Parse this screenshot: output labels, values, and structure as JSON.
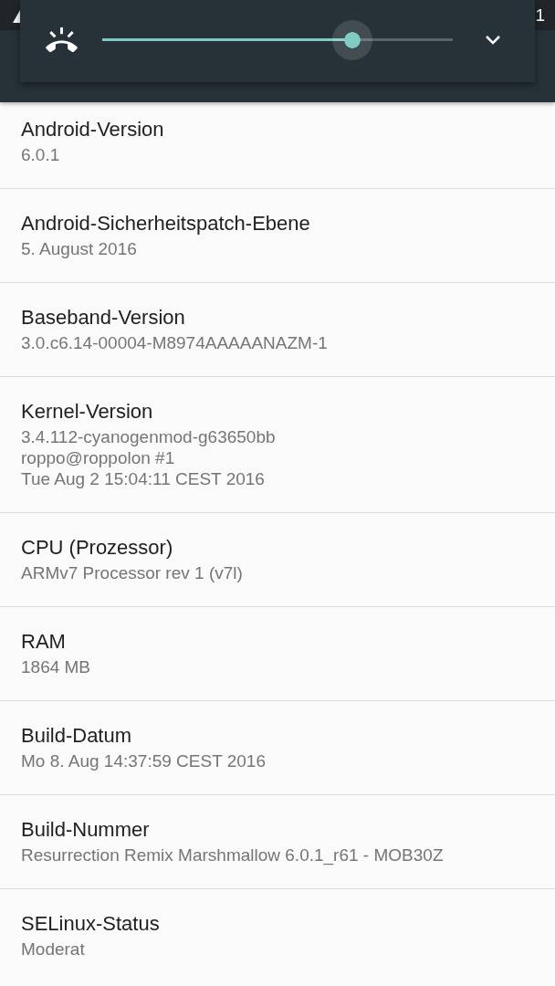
{
  "status_bar": {
    "clock": "1"
  },
  "volume_dialog": {
    "level": 0.713,
    "expanded": false
  },
  "items": [
    {
      "title": "Android-Version",
      "summary": "6.0.1"
    },
    {
      "title": "Android-Sicherheitspatch-Ebene",
      "summary": "5. August 2016"
    },
    {
      "title": "Baseband-Version",
      "summary": "3.0.c6.14-00004-M8974AAAAANAZM-1"
    },
    {
      "title": "Kernel-Version",
      "summary": "3.4.112-cyanogenmod-g63650bb\nroppo@roppolon #1\nTue Aug 2 15:04:11 CEST 2016"
    },
    {
      "title": "CPU (Prozessor)",
      "summary": "ARMv7 Processor rev 1 (v7l)"
    },
    {
      "title": "RAM",
      "summary": "1864 MB"
    },
    {
      "title": "Build-Datum",
      "summary": "Mo 8. Aug 14:37:59 CEST 2016"
    },
    {
      "title": "Build-Nummer",
      "summary": "Resurrection Remix Marshmallow 6.0.1_r61 - MOB30Z"
    },
    {
      "title": "SELinux-Status",
      "summary": "Moderat"
    }
  ]
}
